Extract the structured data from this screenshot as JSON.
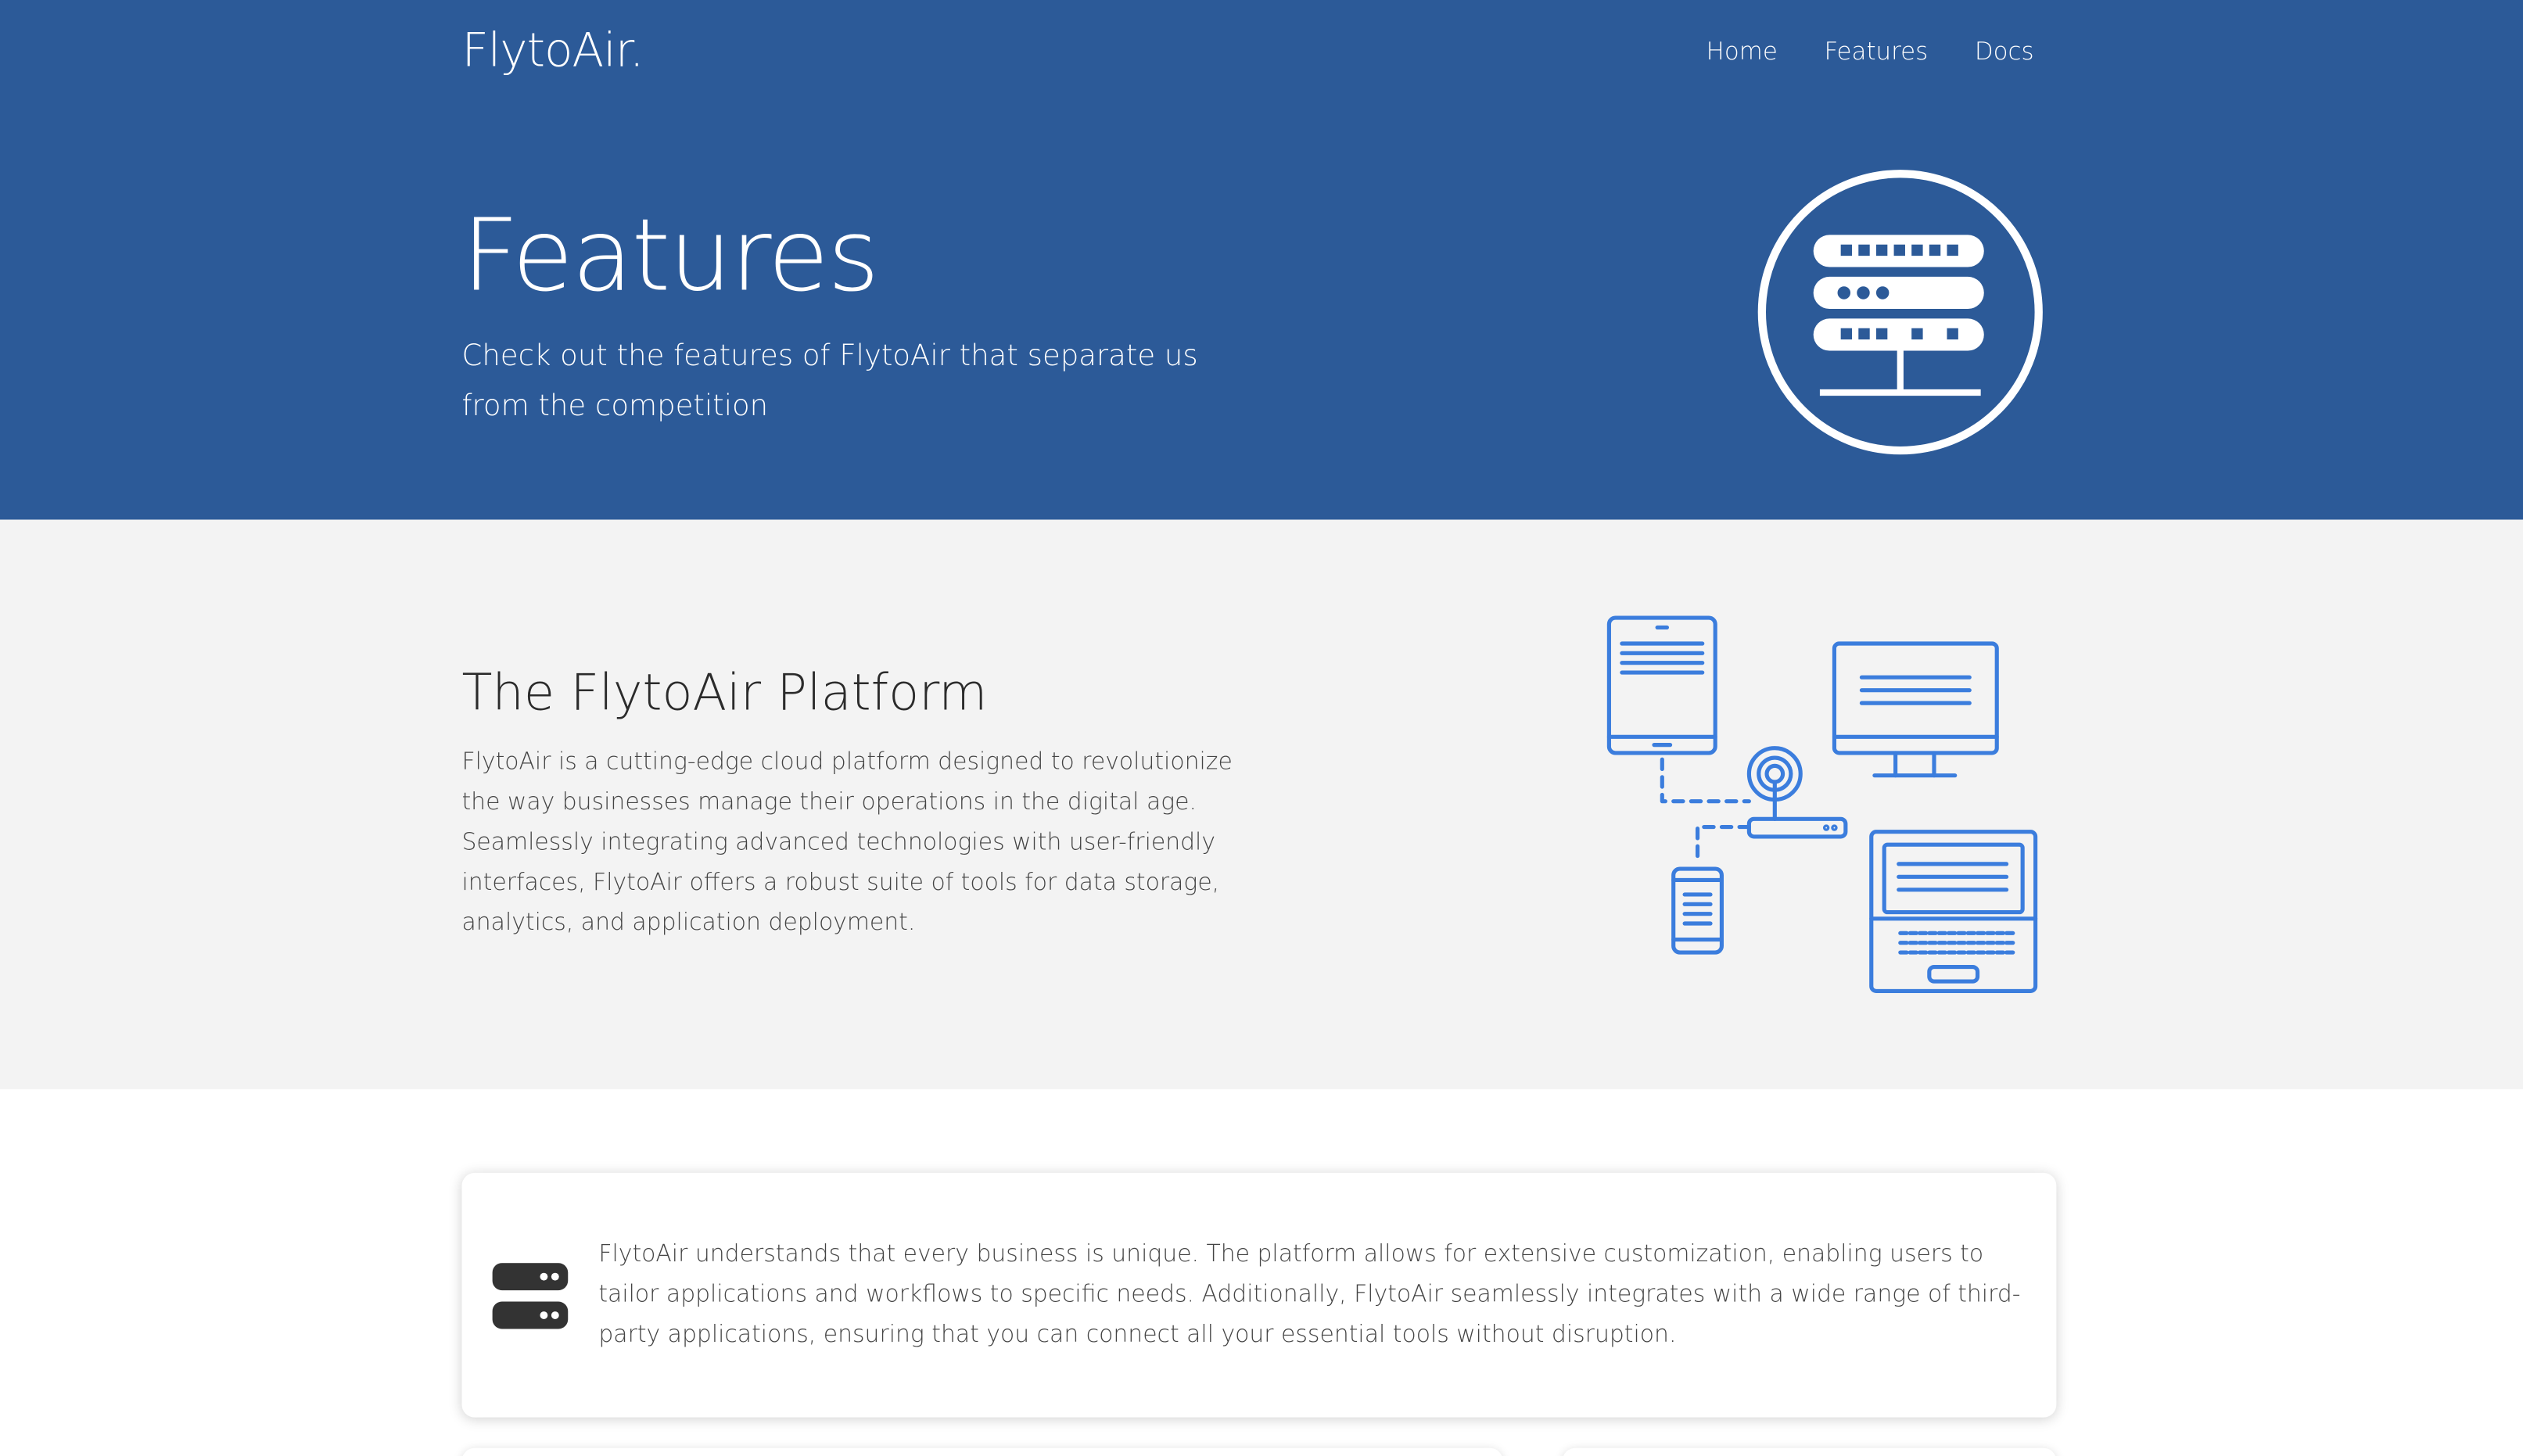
{
  "header": {
    "brand": "FlytoAir.",
    "nav": [
      {
        "label": "Home"
      },
      {
        "label": "Features"
      },
      {
        "label": "Docs"
      }
    ]
  },
  "hero": {
    "title": "Features",
    "subtitle": "Check out the features of FlytoAir that separate us from the competition",
    "icon": "server-rack-icon"
  },
  "platform": {
    "title": "The FlytoAir Platform",
    "body": "FlytoAir is a cutting-edge cloud platform designed to revolutionize the way businesses manage their operations in the digital age. Seamlessly integrating advanced technologies with user-friendly interfaces, FlytoAir offers a robust suite of tools for data storage, analytics, and application deployment.",
    "illustration": "device-network-icon"
  },
  "feature_card": {
    "icon": "server-stack-icon",
    "text": "FlytoAir understands that every business is unique. The platform allows for extensive customization, enabling users to tailor applications and workflows to specific needs. Additionally, FlytoAir seamlessly integrates with a wide range of third-party applications, ensuring that you can connect all your essential tools without disruption."
  },
  "colors": {
    "hero_bg": "#2c5a98",
    "section_bg": "#f3f3f3",
    "illustration_blue": "#3b7ddd",
    "icon_dark": "#333333"
  }
}
